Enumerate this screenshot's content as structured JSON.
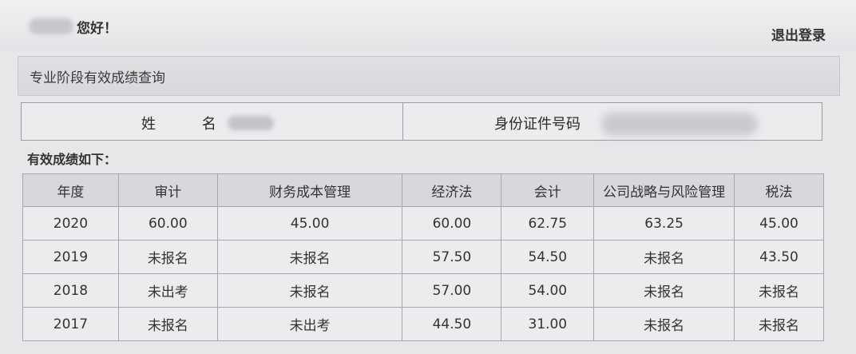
{
  "header": {
    "greeting": "您好！",
    "logout_label": "退出登录"
  },
  "panel": {
    "title": "专业阶段有效成绩查询"
  },
  "info": {
    "name_label": "姓 名",
    "id_label": "身份证件号码"
  },
  "results": {
    "heading": "有效成绩如下：",
    "columns": [
      "年度",
      "审计",
      "财务成本管理",
      "经济法",
      "会计",
      "公司战略与风险管理",
      "税法"
    ],
    "rows": [
      [
        "2020",
        "60.00",
        "45.00",
        "60.00",
        "62.75",
        "63.25",
        "45.00"
      ],
      [
        "2019",
        "未报名",
        "未报名",
        "57.50",
        "54.50",
        "未报名",
        "43.50"
      ],
      [
        "2018",
        "未出考",
        "未报名",
        "57.00",
        "54.00",
        "未报名",
        "未报名"
      ],
      [
        "2017",
        "未报名",
        "未出考",
        "44.50",
        "31.00",
        "未报名",
        "未报名"
      ]
    ]
  }
}
